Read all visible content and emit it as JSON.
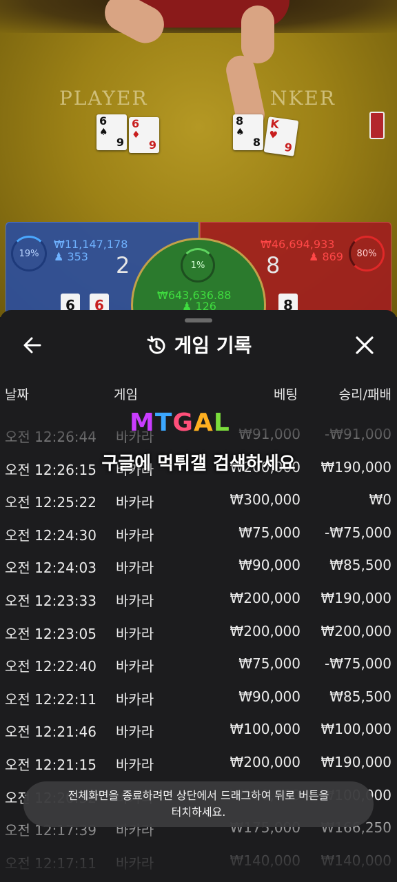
{
  "game_view": {
    "player_label": "PLAYER",
    "banker_label": "NKER",
    "player_cards": [
      {
        "rank": "6",
        "suit": "♠",
        "color": "black",
        "rank_bottom": "9"
      },
      {
        "rank": "6",
        "suit": "♦",
        "color": "red",
        "rank_bottom": "9"
      }
    ],
    "banker_cards": [
      {
        "rank": "8",
        "suit": "♠",
        "color": "black",
        "rank_bottom": "8"
      },
      {
        "rank": "K",
        "suit": "♥",
        "color": "red",
        "rank_bottom": "9"
      }
    ]
  },
  "bet_panel": {
    "player": {
      "percent": "19%",
      "amount": "₩11,147,178",
      "players": "353",
      "score": "2",
      "cards": [
        "6",
        "6"
      ],
      "color": "#4aa8ff"
    },
    "tie": {
      "percent": "1%",
      "amount": "₩643,636.88",
      "players": "126",
      "color": "#3fdc3f"
    },
    "banker": {
      "percent": "80%",
      "amount": "₩46,694,933",
      "players": "869",
      "score": "8",
      "cards": [
        "8"
      ],
      "color": "#ff3b3b"
    }
  },
  "history": {
    "title": "게임 기록",
    "columns": {
      "date": "날짜",
      "game": "게임",
      "bet": "베팅",
      "result": "승리/패배"
    },
    "rows": [
      {
        "time": "오전 12:26:44",
        "game": "바카라",
        "bet": "₩91,000",
        "result": "-₩91,000"
      },
      {
        "time": "오전 12:26:15",
        "game": "바카라",
        "bet": "₩200,000",
        "result": "₩190,000"
      },
      {
        "time": "오전 12:25:22",
        "game": "바카라",
        "bet": "₩300,000",
        "result": "₩0"
      },
      {
        "time": "오전 12:24:30",
        "game": "바카라",
        "bet": "₩75,000",
        "result": "-₩75,000"
      },
      {
        "time": "오전 12:24:03",
        "game": "바카라",
        "bet": "₩90,000",
        "result": "₩85,500"
      },
      {
        "time": "오전 12:23:33",
        "game": "바카라",
        "bet": "₩200,000",
        "result": "₩190,000"
      },
      {
        "time": "오전 12:23:05",
        "game": "바카라",
        "bet": "₩200,000",
        "result": "₩200,000"
      },
      {
        "time": "오전 12:22:40",
        "game": "바카라",
        "bet": "₩75,000",
        "result": "-₩75,000"
      },
      {
        "time": "오전 12:22:11",
        "game": "바카라",
        "bet": "₩90,000",
        "result": "₩85,500"
      },
      {
        "time": "오전 12:21:46",
        "game": "바카라",
        "bet": "₩100,000",
        "result": "₩100,000"
      },
      {
        "time": "오전 12:21:15",
        "game": "바카라",
        "bet": "₩200,000",
        "result": "₩190,000"
      },
      {
        "time": "오전 12:20:52",
        "game": "바카라",
        "bet": "₩100,000",
        "result": "₩100,000"
      },
      {
        "time": "오전 12:17:39",
        "game": "바카라",
        "bet": "₩175,000",
        "result": "₩166,250"
      },
      {
        "time": "오전 12:17:11",
        "game": "바카라",
        "bet": "₩140,000",
        "result": "₩140,000"
      }
    ]
  },
  "watermark": {
    "logo": "MTGAL",
    "text": "구글에 먹튀갤 검색하세요"
  },
  "toast": {
    "line1": "전체화면을 종료하려면 상단에서 드래그하여 뒤로 버튼을",
    "line2": "터치하세요."
  },
  "icons": {
    "back": "arrow-left-icon",
    "close": "close-icon",
    "history": "history-icon",
    "user": "user-icon"
  }
}
